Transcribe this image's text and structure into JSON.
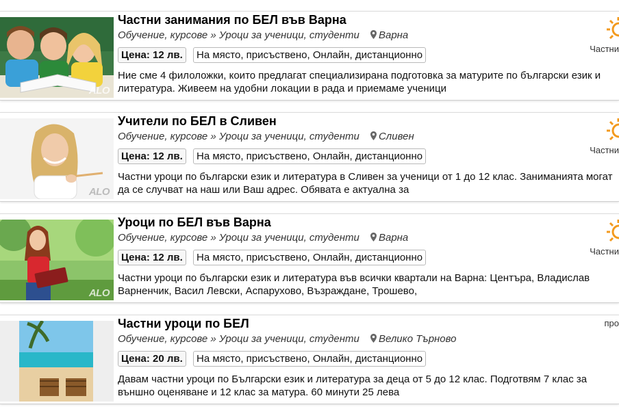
{
  "listings": [
    {
      "title": "Частни занимания по БЕЛ във Варна",
      "category": "Обучение, курсове » Уроци за ученици, студенти",
      "location": "Варна",
      "price": "Цена: 12 лв.",
      "format": "На място, присъствено, Онлайн, дистанционно",
      "description": "Ние сме 4 филоложки, които предлагат специализирана подготовка за матурите по български език и литература. Живеем на удобни локации в рада и приемаме ученици",
      "badge": "Частни",
      "thumb_watermark": "ALO"
    },
    {
      "title": "Учители по БЕЛ в Сливен",
      "category": "Обучение, курсове » Уроци за ученици, студенти",
      "location": "Сливен",
      "price": "Цена: 12 лв.",
      "format": "На място, присъствено, Онлайн, дистанционно",
      "description": "Частни уроци по български език и литература в Сливен за ученици от 1 до 12 клас. Заниманията могат да се случват на наш или Ваш адрес. Обявата е актуална за",
      "badge": "Частни",
      "thumb_watermark": "ALO"
    },
    {
      "title": "Уроци по БЕЛ във Варна",
      "category": "Обучение, курсове » Уроци за ученици, студенти",
      "location": "Варна",
      "price": "Цена: 12 лв.",
      "format": "На място, присъствено, Онлайн, дистанционно",
      "description": "Частни уроци по български език и литература във всички квартали на Варна: Центъра, Владислав Варненчик, Васил Левски, Аспарухово, Възраждане, Трошево,",
      "badge": "Частни",
      "thumb_watermark": "ALO"
    },
    {
      "title": "Частни уроци по БЕЛ",
      "category": "Обучение, курсове » Уроци за ученици, студенти",
      "location": "Велико Търново",
      "price": "Цена: 20 лв.",
      "format": "На място, присъствено, Онлайн, дистанционно",
      "description": "Давам частни уроци по Български език и литература за деца от 5 до 12 клас. Подготвям 7 клас за външно оценяване и 12 клас за матура. 60 минути 25 лева",
      "promo": "про"
    }
  ],
  "colors": {
    "sun": "#f39a1e",
    "border": "#cfcfcf"
  }
}
